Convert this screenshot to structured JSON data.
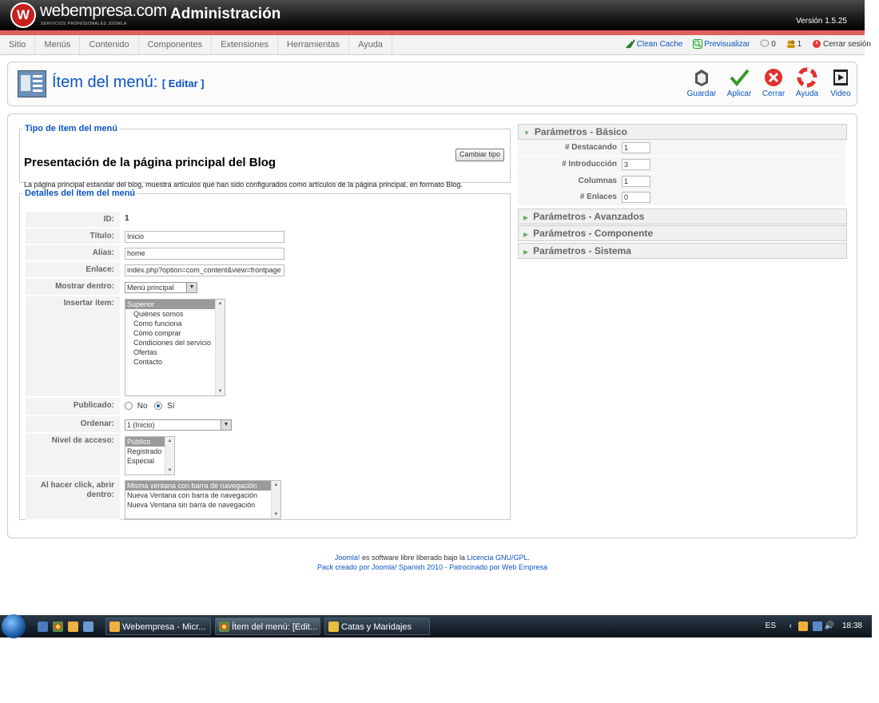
{
  "header": {
    "logo_mark": "W",
    "logo_text": "webempresa.com",
    "logo_sub": "SERVICIOS PROFESIONALES JOOMLA",
    "title": "Administración",
    "version": "Versión 1.5.25"
  },
  "menu": [
    "Sitio",
    "Menús",
    "Contenido",
    "Componentes",
    "Extensiones",
    "Herramientas",
    "Ayuda"
  ],
  "status": {
    "clean_cache": "Clean Cache",
    "preview": "Previsualizar",
    "messages": "0",
    "users": "1",
    "logout": "Cerrar sesión"
  },
  "toolbar": {
    "title": "Ítem del menú:",
    "subtitle": "[ Editar ]",
    "buttons": {
      "save": "Guardar",
      "apply": "Aplicar",
      "close": "Cerrar",
      "help": "Ayuda",
      "video": "Video"
    }
  },
  "type_section": {
    "legend": "Tipo de ítem del menú",
    "title": "Presentación de la página principal del Blog",
    "description": "La página principal estandar del blog, muestra artículos que han sido configurados como artículos de la página principal, en formato Blog.",
    "change_button": "Cambiar tipo"
  },
  "details": {
    "legend": "Detalles del ítem del menú",
    "id_label": "ID:",
    "id_value": "1",
    "title_label": "Título:",
    "title_value": "Inicio",
    "alias_label": "Alias:",
    "alias_value": "home",
    "link_label": "Enlace:",
    "link_value": "index.php?option=com_content&view=frontpage",
    "show_in_label": "Mostrar dentro:",
    "show_in_value": "Menú principal",
    "insert_label": "Insertar ítem:",
    "insert_options": [
      "Superior",
      "Quiénes somos",
      "Como funciona",
      "Cómo comprar",
      "Condiciones del servicio",
      "Ofertas",
      "Contacto"
    ],
    "published_label": "Publicado:",
    "published_no": "No",
    "published_yes": "Sí",
    "order_label": "Ordenar:",
    "order_value": "1 (Inicio)",
    "access_label": "Nivel de acceso:",
    "access_options": [
      "Público",
      "Registrado",
      "Especial"
    ],
    "open_in_label_1": "Al hacer click, abrir",
    "open_in_label_2": "dentro:",
    "open_in_options": [
      "Misma ventana con barra de navegación",
      "Nueva Ventana con barra de navegación",
      "Nueva Ventana sin barra de navegación"
    ]
  },
  "params": {
    "basic_title": "Parámetros - Básico",
    "featured_label": "# Destacando",
    "featured_value": "1",
    "intro_label": "# Introducción",
    "intro_value": "3",
    "columns_label": "Columnas",
    "columns_value": "1",
    "links_label": "# Enlaces",
    "links_value": "0",
    "advanced_title": "Parámetros - Avanzados",
    "component_title": "Parámetros - Componente",
    "system_title": "Parámetros - Sistema"
  },
  "footer": {
    "joomla": "Joomla!",
    "text1": " es software libre liberado bajo la ",
    "license": "Licencia GNU/GPL",
    "text1_end": ".",
    "line2": "Pack creado por Joomla! Spanish 2010 - Patrocinado por Web Empresa"
  },
  "taskbar": {
    "tasks": [
      "Webempresa - Micr...",
      "Ítem del menú: [Edit...",
      "Catas y Maridajes"
    ],
    "lang": "ES",
    "time": "18:38"
  },
  "colors": {
    "accent": "#0b55c4",
    "header_red": "#e06060"
  }
}
